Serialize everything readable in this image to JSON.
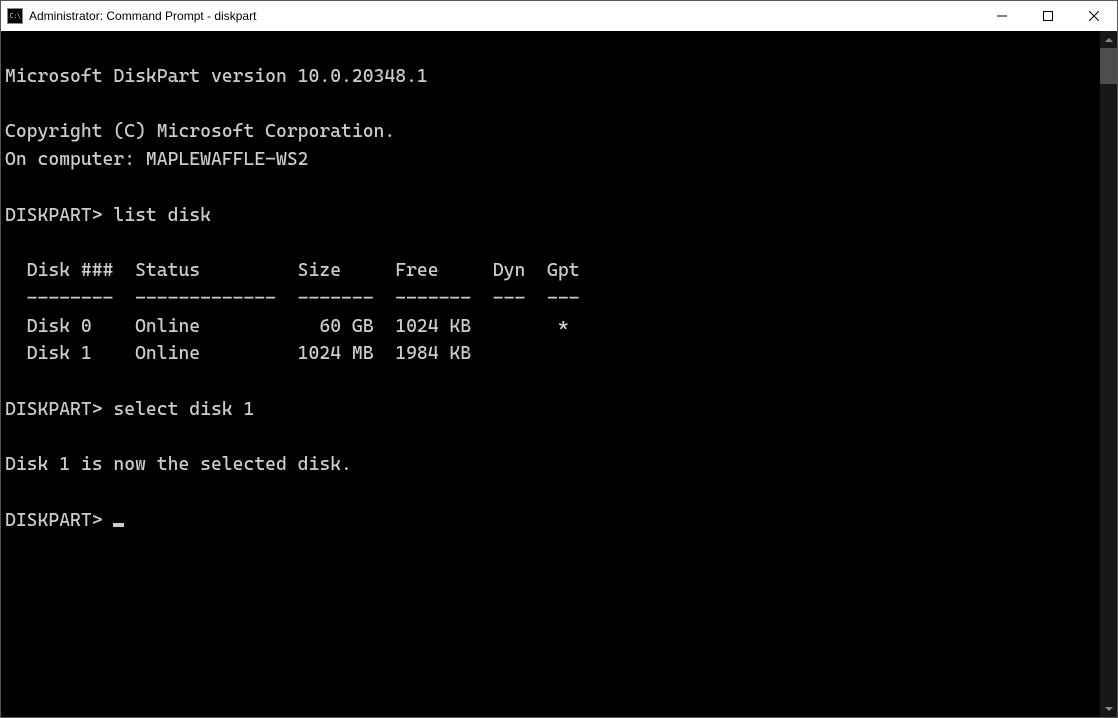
{
  "window": {
    "title": "Administrator: Command Prompt - diskpart"
  },
  "console": {
    "blank0": "",
    "version": "Microsoft DiskPart version 10.0.20348.1",
    "blank1": "",
    "copyright": "Copyright (C) Microsoft Corporation.",
    "computer": "On computer: MAPLEWAFFLE-WS2",
    "blank2": "",
    "prompt1": "DISKPART> list disk",
    "blank3": "",
    "table_header": "  Disk ###  Status         Size     Free     Dyn  Gpt",
    "table_rule": "  --------  -------------  -------  -------  ---  ---",
    "row0": "  Disk 0    Online           60 GB  1024 KB        *",
    "row1": "  Disk 1    Online         1024 MB  1984 KB",
    "blank4": "",
    "prompt2": "DISKPART> select disk 1",
    "blank5": "",
    "result": "Disk 1 is now the selected disk.",
    "blank6": "",
    "prompt3": "DISKPART> "
  },
  "disks": [
    {
      "id": "Disk 0",
      "status": "Online",
      "size": "60 GB",
      "free": "1024 KB",
      "dyn": "",
      "gpt": "*"
    },
    {
      "id": "Disk 1",
      "status": "Online",
      "size": "1024 MB",
      "free": "1984 KB",
      "dyn": "",
      "gpt": ""
    }
  ]
}
